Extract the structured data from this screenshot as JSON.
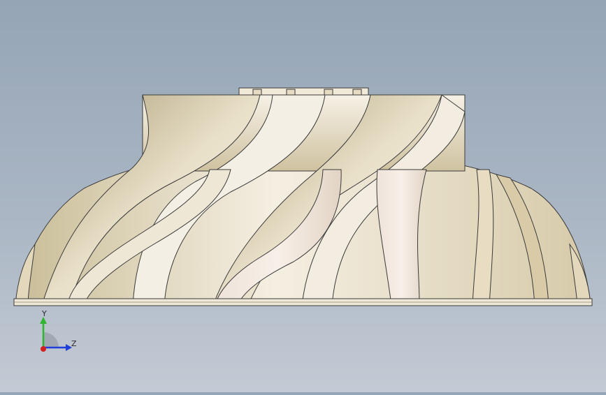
{
  "viewport": {
    "background_top": "#95a5b6",
    "background_bottom": "#c3cad4",
    "model": "impeller",
    "material_color": "#efe6d2",
    "shadow_color": "#b7a985",
    "edge_color": "#3a3a3a"
  },
  "triad": {
    "y_label": "Y",
    "z_label": "Z",
    "y_color": "#2fb52f",
    "z_color": "#1f3fd8",
    "x_color": "#d42020"
  }
}
